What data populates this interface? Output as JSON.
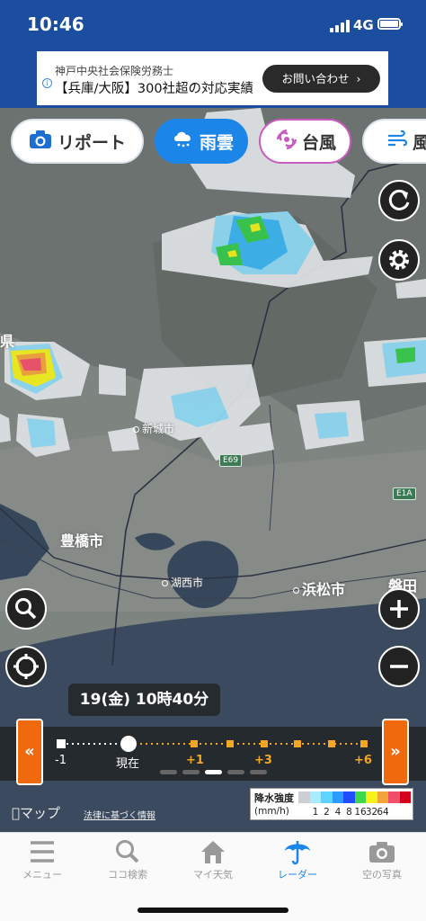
{
  "status": {
    "time": "10:46",
    "network": "4G"
  },
  "ad": {
    "line1": "神戸中央社会保険労務士",
    "line2": "【兵庫/大阪】300社超の対応実績",
    "cta": "お問い合わせ",
    "cta_chevron": "›",
    "info_glyph": "i"
  },
  "tabs": [
    {
      "label": "リポート",
      "icon": "camera-icon"
    },
    {
      "label": "雨雲",
      "icon": "rain-cloud-icon"
    },
    {
      "label": "台風",
      "icon": "typhoon-icon"
    },
    {
      "label": "風",
      "icon": "wind-icon"
    }
  ],
  "map": {
    "places": [
      {
        "name": "新城市"
      },
      {
        "name": "豊橋市"
      },
      {
        "name": "湖西市"
      },
      {
        "name": "浜松市"
      },
      {
        "name": "磐田市"
      },
      {
        "name": "県"
      }
    ],
    "roads": [
      "E69",
      "E1A"
    ]
  },
  "timeline": {
    "date_label": "19(金) 10時40分",
    "labels": [
      "-1",
      "現在",
      "+1",
      "+3",
      "+6"
    ],
    "back_glyph": "«",
    "forward_glyph": "»",
    "pager_count": 5,
    "pager_active": 2
  },
  "legend": {
    "title": "降水強度",
    "unit": "(mm/h)",
    "colors": [
      "#ccd0d4",
      "#a8ecff",
      "#5ed3ff",
      "#2a9bff",
      "#1f4dff",
      "#3ed84a",
      "#f7f21a",
      "#f2a33a",
      "#f04e6a",
      "#d7001a"
    ],
    "values": [
      "1",
      "2",
      "4",
      "8",
      "16",
      "32",
      "64"
    ]
  },
  "attribution": {
    "maps": "マップ",
    "legal": "法律に基づく情報"
  },
  "bottom_nav": [
    {
      "label": "メニュー",
      "icon": "menu-icon",
      "active": false
    },
    {
      "label": "ココ検索",
      "icon": "search-icon",
      "active": false
    },
    {
      "label": "マイ天気",
      "icon": "home-icon",
      "active": false
    },
    {
      "label": "レーダー",
      "icon": "umbrella-icon",
      "active": true
    },
    {
      "label": "空の写真",
      "icon": "camera-icon",
      "active": false
    }
  ]
}
